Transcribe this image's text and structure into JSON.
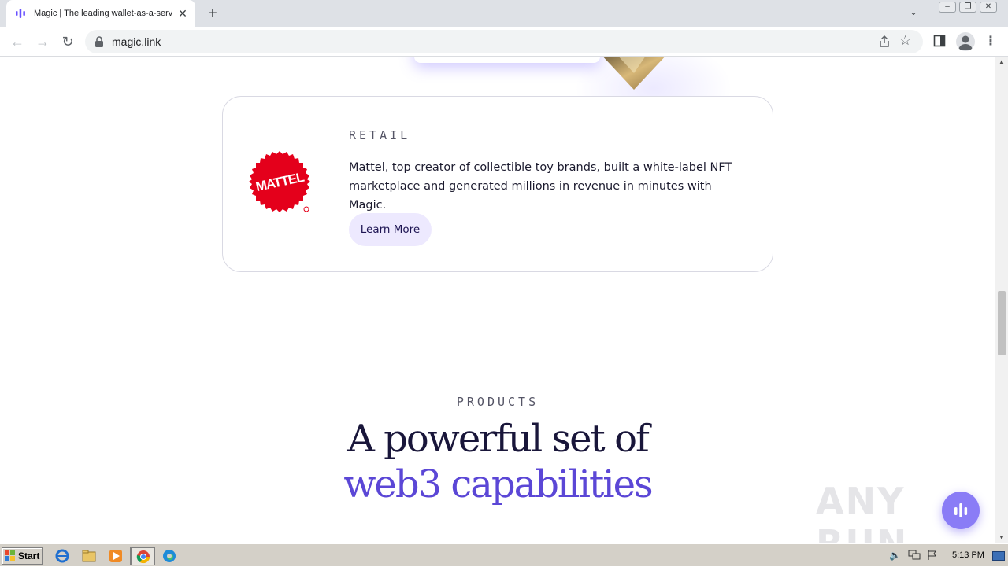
{
  "browser": {
    "tab_title": "Magic | The leading wallet-as-a-service",
    "url": "magic.link"
  },
  "page": {
    "case_study": {
      "eyebrow": "RETAIL",
      "logo_text": "MATTEL",
      "description": "Mattel, top creator of collectible toy brands, built a white-label NFT marketplace and generated millions in revenue in minutes with Magic.",
      "cta_label": "Learn More"
    },
    "products": {
      "eyebrow": "PRODUCTS",
      "headline_line1": "A powerful set of",
      "headline_line2": "web3 capabilities"
    },
    "watermark": "ANY RUN"
  },
  "taskbar": {
    "start_label": "Start",
    "clock": "5:13 PM"
  },
  "colors": {
    "brand_purple": "#5b47d6",
    "button_bg": "#ede9fe",
    "mattel_red": "#e4001b"
  }
}
